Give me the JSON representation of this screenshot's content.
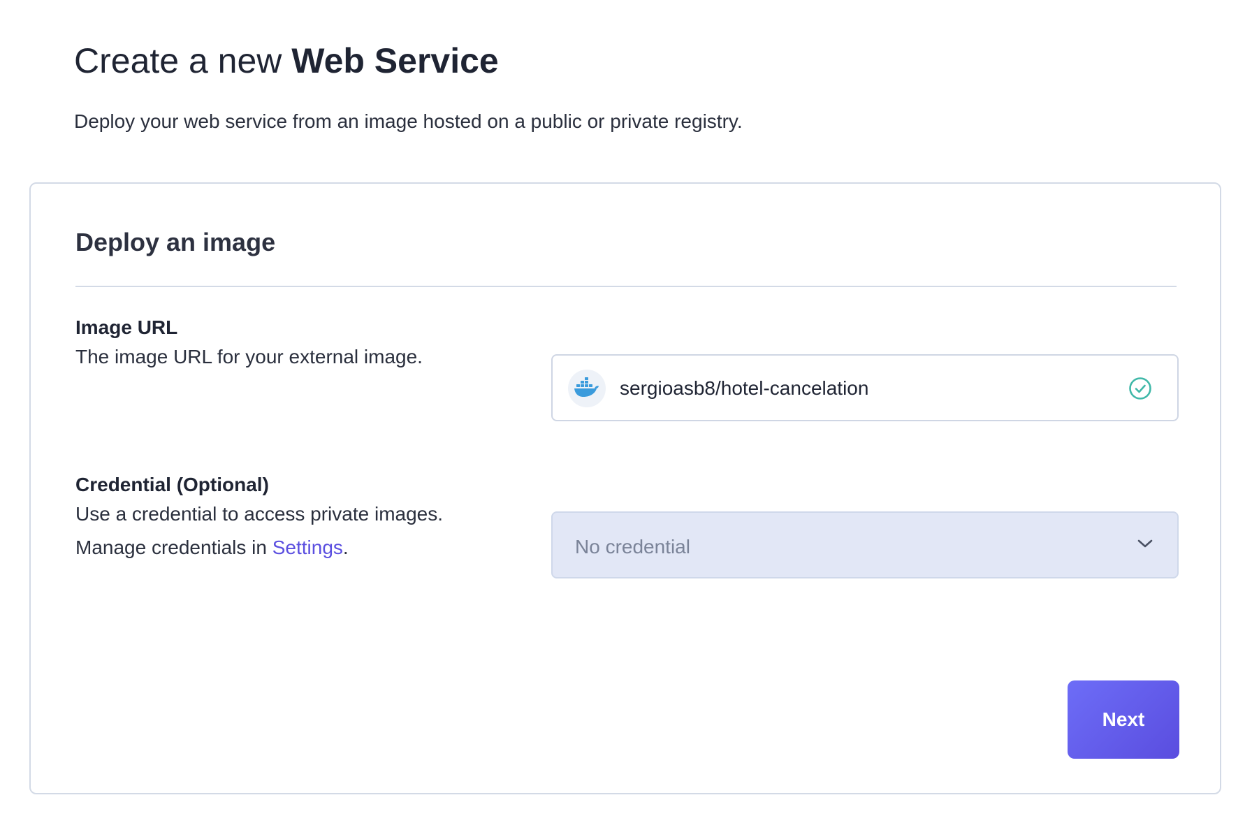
{
  "header": {
    "title_prefix": "Create a new ",
    "title_strong": "Web Service",
    "subtitle": "Deploy your web service from an image hosted on a public or private registry."
  },
  "card": {
    "title": "Deploy an image",
    "image_url": {
      "label": "Image URL",
      "description": "The image URL for your external image.",
      "value": "sergioasb8/hotel-cancelation",
      "icon": "docker-icon",
      "status_icon": "check-circle-icon"
    },
    "credential": {
      "label": "Credential (Optional)",
      "description": "Use a credential to access private images.",
      "manage_prefix": "Manage credentials in ",
      "manage_link": "Settings",
      "manage_suffix": ".",
      "selected": "No credential",
      "icon": "chevron-down-icon"
    },
    "next_label": "Next"
  },
  "colors": {
    "accent": "#5b4fe0",
    "button_start": "#6d6df7",
    "button_end": "#5a4ddf",
    "success": "#3fb8a8",
    "docker_blue": "#3b9bdc",
    "select_bg": "#e2e7f6",
    "border": "#d3dae6"
  }
}
